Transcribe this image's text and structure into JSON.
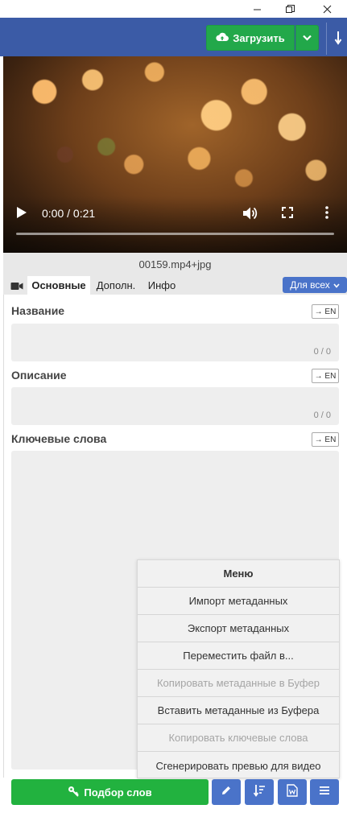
{
  "window": {
    "minimize_icon": "minimize-icon",
    "restore_icon": "restore-icon",
    "close_icon": "close-icon"
  },
  "header": {
    "upload_label": "Загрузить",
    "upload_icon": "cloud-upload-icon",
    "dropdown_icon": "chevron-down-icon",
    "download_icon": "arrow-down-icon",
    "accent_color": "#3b5ba6",
    "upload_color": "#22a84a"
  },
  "video": {
    "time": "0:00 / 0:21",
    "progress": 0
  },
  "file": {
    "name": "00159.mp4+jpg"
  },
  "tabs": {
    "items": [
      {
        "label": "Основные",
        "active": true
      },
      {
        "label": "Дополн.",
        "active": false
      },
      {
        "label": "Инфо",
        "active": false
      }
    ],
    "scope_label": "Для всех"
  },
  "form": {
    "translate_label": "→ EN",
    "title": {
      "label": "Название",
      "counter": "0 / 0"
    },
    "description": {
      "label": "Описание",
      "counter": "0 / 0"
    },
    "keywords": {
      "label": "Ключевые слова"
    }
  },
  "menu": {
    "title": "Меню",
    "items": [
      {
        "label": "Импорт метаданных",
        "enabled": true
      },
      {
        "label": "Экспорт метаданных",
        "enabled": true
      },
      {
        "label": "Переместить файл в...",
        "enabled": true
      },
      {
        "label": "Копировать метаданные в Буфер",
        "enabled": false
      },
      {
        "label": "Вставить метаданные из Буфера",
        "enabled": true
      },
      {
        "label": "Копировать ключевые слова",
        "enabled": false
      },
      {
        "label": "Сгенерировать превью для видео",
        "enabled": true
      }
    ]
  },
  "bottom": {
    "pick_words_label": "Подбор слов",
    "pick_words_icon": "key-icon",
    "edit_icon": "pencil-icon",
    "sort_icon": "sort-icon",
    "word_doc_icon": "word-document-icon",
    "menu_icon": "hamburger-menu-icon",
    "accent_color": "#22b23f"
  }
}
